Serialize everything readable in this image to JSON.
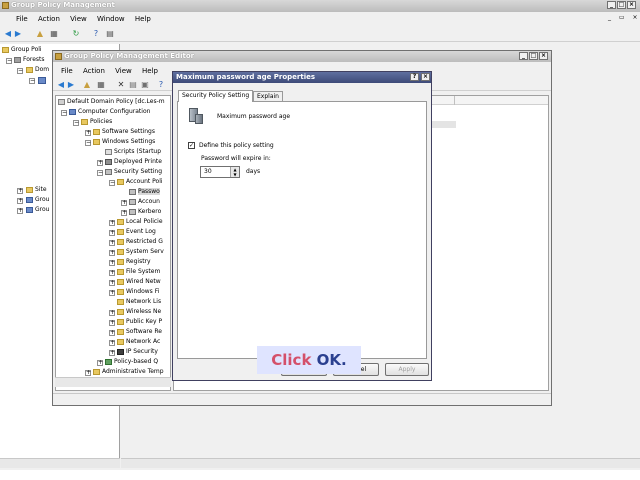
{
  "gpm": {
    "title": "Group Policy Management",
    "menu": [
      "File",
      "Action",
      "View",
      "Window",
      "Help"
    ],
    "tree": [
      "Group Poli",
      "Forests",
      "Dom"
    ],
    "tree_lower": [
      "Site",
      "Grou",
      "Grou"
    ]
  },
  "editor": {
    "title": "Group Policy Management Editor",
    "menu": [
      "File",
      "Action",
      "View",
      "Help"
    ],
    "tree": {
      "root": "Default Domain Policy [dc.Les-m",
      "computer_config": "Computer Configuration",
      "policies": "Policies",
      "software_settings": "Software Settings",
      "windows_settings": "Windows Settings",
      "scripts": "Scripts (Startup",
      "deployed_printers": "Deployed Printe",
      "security_settings": "Security Setting",
      "account_policies": "Account Poli",
      "password": "Passwo",
      "account_lockout": "Accoun",
      "kerberos": "Kerbero",
      "local_policies": "Local Policie",
      "event_log": "Event Log",
      "restricted": "Restricted G",
      "system_services": "System Serv",
      "registry": "Registry",
      "file_system": "File System",
      "wired_network": "Wired Netw",
      "windows_firewall": "Windows Fi",
      "network_list": "Network Lis",
      "wireless_network": "Wireless Ne",
      "public_key": "Public Key P",
      "software_restriction": "Software Re",
      "network_access": "Network Ac",
      "ip_security": "IP Security",
      "policy_based_qos": "Policy-based Q",
      "admin_templates": "Administrative Temp"
    }
  },
  "dialog": {
    "title": "Maximum password age Properties",
    "tabs": [
      "Security Policy Setting",
      "Explain"
    ],
    "policy_name": "Maximum password age",
    "define_label": "Define this policy setting",
    "define_checked": true,
    "expire_label": "Password will expire in:",
    "expire_value": "30",
    "unit": "days",
    "ok": "OK",
    "cancel": "Cancel",
    "apply": "Apply"
  },
  "annotation": {
    "prefix": "Click ",
    "target": "OK",
    "suffix": ".",
    "colors": {
      "prefix": "#d4506a",
      "target": "#2a3f8f",
      "background": "#dfe4ff"
    }
  }
}
